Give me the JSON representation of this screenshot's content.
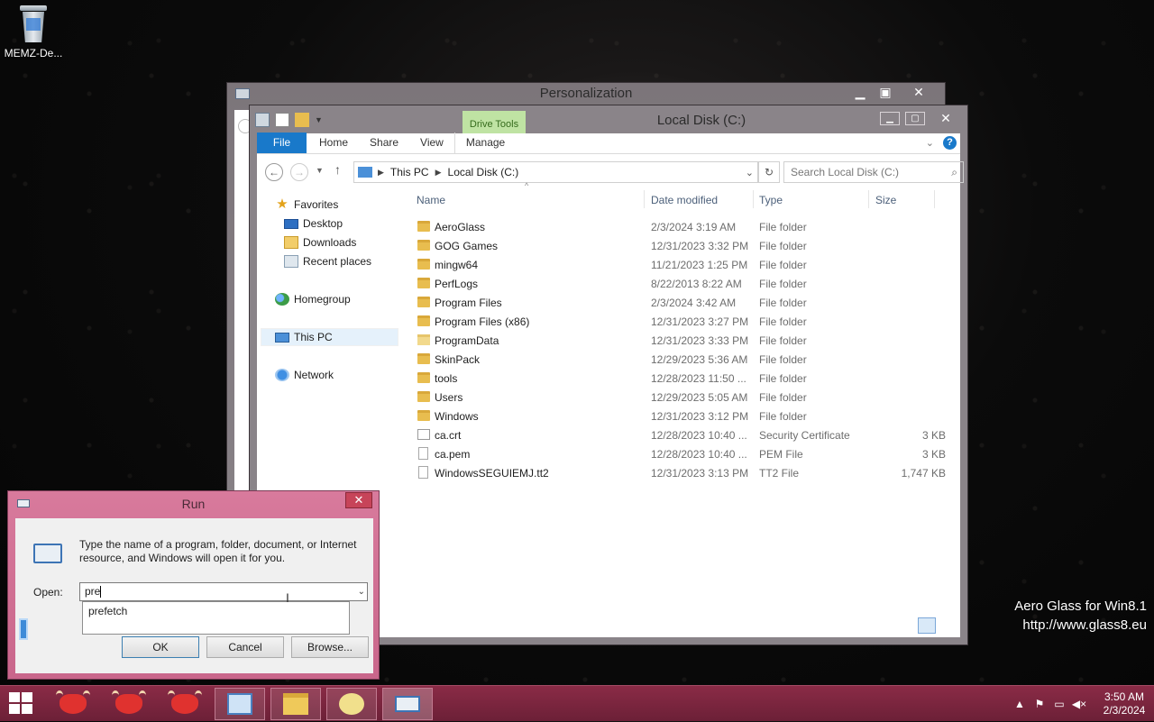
{
  "desktop": {
    "icons": [
      {
        "label": "MEMZ-De...",
        "icon": "recycle-bin-icon"
      }
    ],
    "watermark": {
      "line1": "Aero Glass for Win8.1",
      "line2": "http://www.glass8.eu"
    }
  },
  "personalization": {
    "title": "Personalization"
  },
  "explorer": {
    "title": "Local Disk (C:)",
    "context_tab": "Drive Tools",
    "tabs": [
      "File",
      "Home",
      "Share",
      "View",
      "Manage"
    ],
    "address": {
      "segments": [
        "This PC",
        "Local Disk (C:)"
      ]
    },
    "search_placeholder": "Search Local Disk (C:)",
    "nav": {
      "favorites": "Favorites",
      "desktop": "Desktop",
      "downloads": "Downloads",
      "recent": "Recent places",
      "homegroup": "Homegroup",
      "this_pc": "This PC",
      "network": "Network"
    },
    "columns": {
      "name": "Name",
      "date": "Date modified",
      "type": "Type",
      "size": "Size"
    },
    "files": [
      {
        "name": "AeroGlass",
        "date": "2/3/2024 3:19 AM",
        "type": "File folder",
        "size": "",
        "icon": "folder"
      },
      {
        "name": "GOG Games",
        "date": "12/31/2023 3:32 PM",
        "type": "File folder",
        "size": "",
        "icon": "folder"
      },
      {
        "name": "mingw64",
        "date": "11/21/2023 1:25 PM",
        "type": "File folder",
        "size": "",
        "icon": "folder"
      },
      {
        "name": "PerfLogs",
        "date": "8/22/2013 8:22 AM",
        "type": "File folder",
        "size": "",
        "icon": "folder"
      },
      {
        "name": "Program Files",
        "date": "2/3/2024 3:42 AM",
        "type": "File folder",
        "size": "",
        "icon": "folder"
      },
      {
        "name": "Program Files (x86)",
        "date": "12/31/2023 3:27 PM",
        "type": "File folder",
        "size": "",
        "icon": "folder"
      },
      {
        "name": "ProgramData",
        "date": "12/31/2023 3:33 PM",
        "type": "File folder",
        "size": "",
        "icon": "folder-light"
      },
      {
        "name": "SkinPack",
        "date": "12/29/2023 5:36 AM",
        "type": "File folder",
        "size": "",
        "icon": "folder"
      },
      {
        "name": "tools",
        "date": "12/28/2023 11:50 ...",
        "type": "File folder",
        "size": "",
        "icon": "folder"
      },
      {
        "name": "Users",
        "date": "12/29/2023 5:05 AM",
        "type": "File folder",
        "size": "",
        "icon": "folder"
      },
      {
        "name": "Windows",
        "date": "12/31/2023 3:12 PM",
        "type": "File folder",
        "size": "",
        "icon": "folder"
      },
      {
        "name": "ca.crt",
        "date": "12/28/2023 10:40 ...",
        "type": "Security Certificate",
        "size": "3 KB",
        "icon": "cert"
      },
      {
        "name": "ca.pem",
        "date": "12/28/2023 10:40 ...",
        "type": "PEM File",
        "size": "3 KB",
        "icon": "doc"
      },
      {
        "name": "WindowsSEGUIEMJ.tt2",
        "date": "12/31/2023 3:13 PM",
        "type": "TT2 File",
        "size": "1,747 KB",
        "icon": "doc"
      }
    ]
  },
  "run": {
    "title": "Run",
    "description": "Type the name of a program, folder, document, or Internet resource, and Windows will open it for you.",
    "open_label": "Open:",
    "value": "pre",
    "suggestion": "prefetch",
    "ok": "OK",
    "cancel": "Cancel",
    "browse": "Browse..."
  },
  "taskbar": {
    "clock": {
      "time": "3:50 AM",
      "date": "2/3/2024"
    }
  }
}
